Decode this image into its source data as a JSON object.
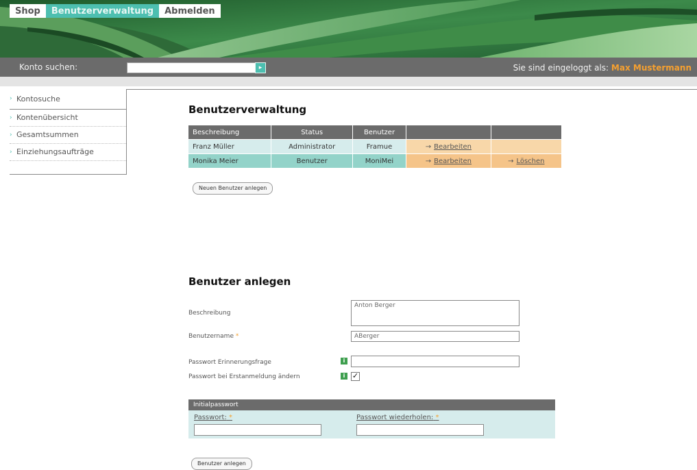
{
  "nav": {
    "tabs": [
      {
        "label": "Shop"
      },
      {
        "label": "Benutzerverwaltung",
        "active": true
      },
      {
        "label": "Abmelden"
      }
    ]
  },
  "searchbar": {
    "label": "Konto suchen:",
    "value": "",
    "login_prefix": "Sie sind eingeloggt als:",
    "user": "Max Mustermann"
  },
  "sidebar": {
    "items": [
      {
        "label": "Kontosuche"
      },
      {
        "label": "Kontenübersicht"
      },
      {
        "label": "Gesamtsummen"
      },
      {
        "label": "Einziehungsaufträge"
      }
    ]
  },
  "users": {
    "title": "Benutzerverwaltung",
    "columns": [
      "Beschreibung",
      "Status",
      "Benutzer",
      "",
      ""
    ],
    "rows": [
      {
        "description": "Franz Müller",
        "status": "Administrator",
        "user": "Framue",
        "edit": "Bearbeiten",
        "delete": ""
      },
      {
        "description": "Monika Meier",
        "status": "Benutzer",
        "user": "MoniMei",
        "edit": "Bearbeiten",
        "delete": "Löschen"
      }
    ],
    "new_button": "Neuen Benutzer anlegen"
  },
  "form": {
    "title": "Benutzer anlegen",
    "description_label": "Beschreibung",
    "description_value": "Anton Berger",
    "username_label": "Benutzername",
    "required_mark": "*",
    "username_value": "ABerger",
    "reminder_label": "Passwort Erinnerungsfrage",
    "reminder_value": "",
    "change_pw_label": "Passwort bei Erstanmeldung ändern",
    "change_pw_checked": true,
    "info_glyph": "i",
    "check_glyph": "✓",
    "initial_password": {
      "header": "Initialpasswort",
      "password_label": "Passwort:",
      "repeat_label": "Passwort wiederholen:"
    },
    "submit": "Benutzer anlegen"
  },
  "colors": {
    "accent_teal": "#4dbfb0",
    "dark_bar": "#6b6b6b",
    "action_orange": "#f8d7a9",
    "user_highlight": "#f5a030"
  }
}
